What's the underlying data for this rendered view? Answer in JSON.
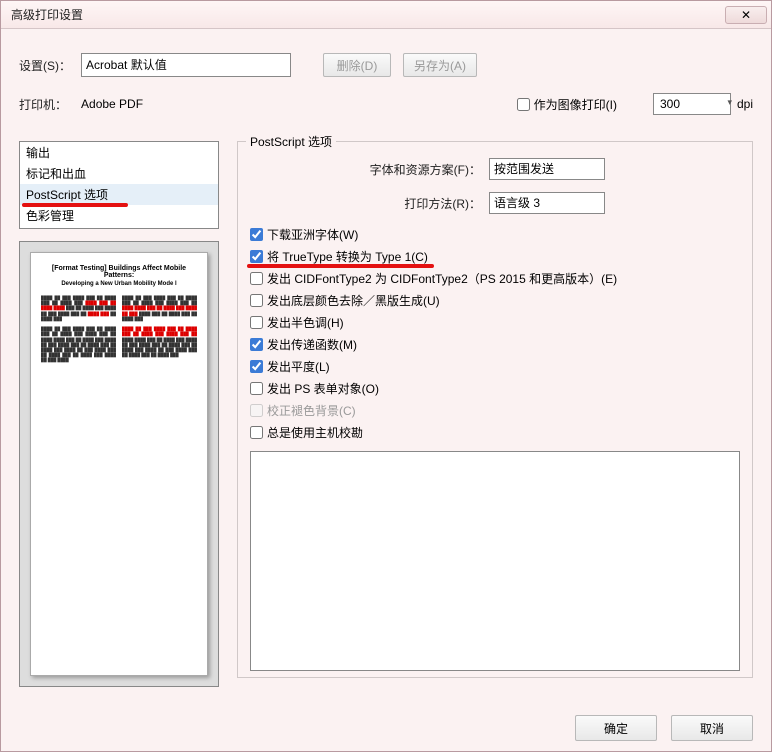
{
  "window": {
    "title": "高级打印设置"
  },
  "toolbar": {
    "settings_label": "设置(S)：",
    "settings_value": "Acrobat 默认值",
    "delete_label": "删除(D)",
    "saveas_label": "另存为(A)"
  },
  "printer": {
    "label": "打印机：",
    "name": "Adobe PDF",
    "asimage_label": "作为图像打印(I)",
    "asimage_checked": false,
    "dpi_value": "300",
    "dpi_unit": "dpi"
  },
  "nav": {
    "items": [
      "输出",
      "标记和出血",
      "PostScript 选项",
      "色彩管理"
    ],
    "selected_index": 2
  },
  "postscript": {
    "groupbox_label": "PostScript 选项",
    "font_policy_label": "字体和资源方案(F)：",
    "font_policy_value": "按范围发送",
    "print_method_label": "打印方法(R)：",
    "print_method_value": "语言级 3",
    "checks": [
      {
        "label": "下载亚洲字体(W)",
        "checked": true,
        "interactable": true
      },
      {
        "label": "将 TrueType 转换为 Type 1(C)",
        "checked": true,
        "interactable": true,
        "highlight": true
      },
      {
        "label": "发出 CIDFontType2 为 CIDFontType2（PS 2015 和更高版本）(E)",
        "checked": false,
        "interactable": true
      },
      {
        "label": "发出底层颜色去除／黑版生成(U)",
        "checked": false,
        "interactable": true
      },
      {
        "label": "发出半色调(H)",
        "checked": false,
        "interactable": true
      },
      {
        "label": "发出传递函数(M)",
        "checked": true,
        "interactable": true
      },
      {
        "label": "发出平度(L)",
        "checked": true,
        "interactable": true
      },
      {
        "label": "发出 PS 表单对象(O)",
        "checked": false,
        "interactable": true
      },
      {
        "label": "校正褪色背景(C)",
        "checked": false,
        "interactable": false
      },
      {
        "label": "总是使用主机校勘",
        "checked": false,
        "interactable": true
      }
    ]
  },
  "preview": {
    "title": "[Format Testing] Buildings Affect Mobile Patterns:",
    "subtitle": "Developing a New Urban Mobility Mode l"
  },
  "footer": {
    "ok_label": "确定",
    "cancel_label": "取消"
  }
}
